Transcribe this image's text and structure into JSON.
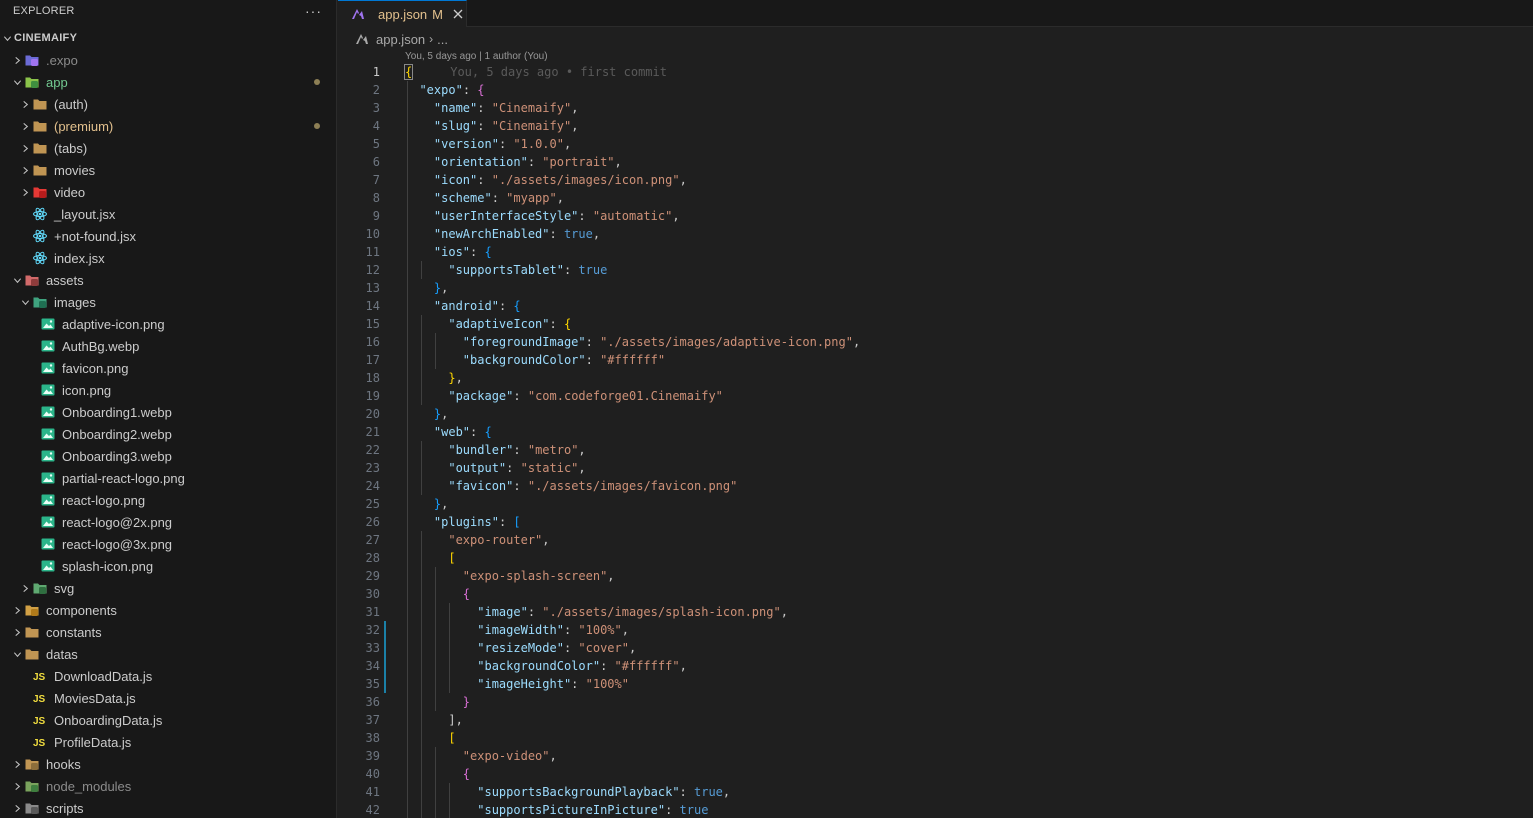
{
  "explorer": {
    "title": "EXPLORER",
    "more": "···",
    "rows": [
      {
        "label": "CINEMAIFY",
        "depth": 0,
        "kind": "root",
        "open": true
      },
      {
        "label": ".expo",
        "depth": 1,
        "kind": "expo",
        "open": false,
        "dim": true
      },
      {
        "label": "app",
        "depth": 1,
        "kind": "folder-app",
        "open": true,
        "status": "app",
        "dot": true
      },
      {
        "label": "(auth)",
        "depth": 2,
        "kind": "folder",
        "open": false
      },
      {
        "label": "(premium)",
        "depth": 2,
        "kind": "folder",
        "open": false,
        "status": "mod",
        "dot": true
      },
      {
        "label": "(tabs)",
        "depth": 2,
        "kind": "folder",
        "open": false
      },
      {
        "label": "movies",
        "depth": 2,
        "kind": "folder",
        "open": false
      },
      {
        "label": "video",
        "depth": 2,
        "kind": "folder-video",
        "open": false
      },
      {
        "label": "_layout.jsx",
        "depth": 2,
        "kind": "react"
      },
      {
        "label": "+not-found.jsx",
        "depth": 2,
        "kind": "react"
      },
      {
        "label": "index.jsx",
        "depth": 2,
        "kind": "react"
      },
      {
        "label": "assets",
        "depth": 1,
        "kind": "folder-assets",
        "open": true
      },
      {
        "label": "images",
        "depth": 2,
        "kind": "folder-images",
        "open": true
      },
      {
        "label": "adaptive-icon.png",
        "depth": 3,
        "kind": "image"
      },
      {
        "label": "AuthBg.webp",
        "depth": 3,
        "kind": "image"
      },
      {
        "label": "favicon.png",
        "depth": 3,
        "kind": "image"
      },
      {
        "label": "icon.png",
        "depth": 3,
        "kind": "image"
      },
      {
        "label": "Onboarding1.webp",
        "depth": 3,
        "kind": "image"
      },
      {
        "label": "Onboarding2.webp",
        "depth": 3,
        "kind": "image"
      },
      {
        "label": "Onboarding3.webp",
        "depth": 3,
        "kind": "image"
      },
      {
        "label": "partial-react-logo.png",
        "depth": 3,
        "kind": "image"
      },
      {
        "label": "react-logo.png",
        "depth": 3,
        "kind": "image"
      },
      {
        "label": "react-logo@2x.png",
        "depth": 3,
        "kind": "image"
      },
      {
        "label": "react-logo@3x.png",
        "depth": 3,
        "kind": "image"
      },
      {
        "label": "splash-icon.png",
        "depth": 3,
        "kind": "image"
      },
      {
        "label": "svg",
        "depth": 2,
        "kind": "folder-svg",
        "open": false
      },
      {
        "label": "components",
        "depth": 1,
        "kind": "folder-components",
        "open": false
      },
      {
        "label": "constants",
        "depth": 1,
        "kind": "folder",
        "open": false
      },
      {
        "label": "datas",
        "depth": 1,
        "kind": "folder-open",
        "open": true
      },
      {
        "label": "DownloadData.js",
        "depth": 2,
        "kind": "js"
      },
      {
        "label": "MoviesData.js",
        "depth": 2,
        "kind": "js"
      },
      {
        "label": "OnboardingData.js",
        "depth": 2,
        "kind": "js"
      },
      {
        "label": "ProfileData.js",
        "depth": 2,
        "kind": "js"
      },
      {
        "label": "hooks",
        "depth": 1,
        "kind": "folder-hooks",
        "open": false
      },
      {
        "label": "node_modules",
        "depth": 1,
        "kind": "folder-node",
        "open": false,
        "dim": true
      },
      {
        "label": "scripts",
        "depth": 1,
        "kind": "folder-scripts",
        "open": false
      }
    ]
  },
  "tab": {
    "label": "app.json",
    "status": "M",
    "icon": "expo-icon"
  },
  "breadcrumb": {
    "file": "app.json",
    "rest": "..."
  },
  "codelens": "You, 5 days ago | 1 author (You)",
  "blame": "You, 5 days ago • first commit",
  "colors": {
    "accent": "#0078d4",
    "modified": "#e2c08d",
    "added": "#73c991",
    "key": "#9cdcfe",
    "string": "#ce9178",
    "bool": "#569cd6"
  },
  "code_lines": [
    "[[br1|{]]",
    "  [[k|\"expo\"]]: [[br2|{]]",
    "    [[k|\"name\"]]: [[s|\"Cinemaify\"]],",
    "    [[k|\"slug\"]]: [[s|\"Cinemaify\"]],",
    "    [[k|\"version\"]]: [[s|\"1.0.0\"]],",
    "    [[k|\"orientation\"]]: [[s|\"portrait\"]],",
    "    [[k|\"icon\"]]: [[s|\"./assets/images/icon.png\"]],",
    "    [[k|\"scheme\"]]: [[s|\"myapp\"]],",
    "    [[k|\"userInterfaceStyle\"]]: [[s|\"automatic\"]],",
    "    [[k|\"newArchEnabled\"]]: [[b|true]],",
    "    [[k|\"ios\"]]: [[br3|{]]",
    "      [[k|\"supportsTablet\"]]: [[b|true]]",
    "    [[br3|}]],",
    "    [[k|\"android\"]]: [[br3|{]]",
    "      [[k|\"adaptiveIcon\"]]: [[br1|{]]",
    "        [[k|\"foregroundImage\"]]: [[s|\"./assets/images/adaptive-icon.png\"]],",
    "        [[k|\"backgroundColor\"]]: [[s|\"#ffffff\"]]",
    "      [[br1|}]],",
    "      [[k|\"package\"]]: [[s|\"com.codeforge01.Cinemaify\"]]",
    "    [[br3|}]],",
    "    [[k|\"web\"]]: [[br3|{]]",
    "      [[k|\"bundler\"]]: [[s|\"metro\"]],",
    "      [[k|\"output\"]]: [[s|\"static\"]],",
    "      [[k|\"favicon\"]]: [[s|\"./assets/images/favicon.png\"]]",
    "    [[br3|}]],",
    "    [[k|\"plugins\"]]: [[br3|[]]",
    "      [[s|\"expo-router\"]],",
    "      [[br1|[]]",
    "        [[s|\"expo-splash-screen\"]],",
    "        [[br2|{]]",
    "          [[k|\"image\"]]: [[s|\"./assets/images/splash-icon.png\"]],",
    "          [[k|\"imageWidth\"]]: [[s|\"100%\"]],",
    "          [[k|\"resizeMode\"]]: [[s|\"cover\"]],",
    "          [[k|\"backgroundColor\"]]: [[s|\"#ffffff\"]],",
    "          [[k|\"imageHeight\"]]: [[s|\"100%\"]]",
    "        [[br2|}]]",
    "      [[br1|]]],",
    "      [[br1|[]]",
    "        [[s|\"expo-video\"]],",
    "        [[br2|{]]",
    "          [[k|\"supportsBackgroundPlayback\"]]: [[b|true]],",
    "          [[k|\"supportsPictureInPicture\"]]: [[b|true]]"
  ]
}
